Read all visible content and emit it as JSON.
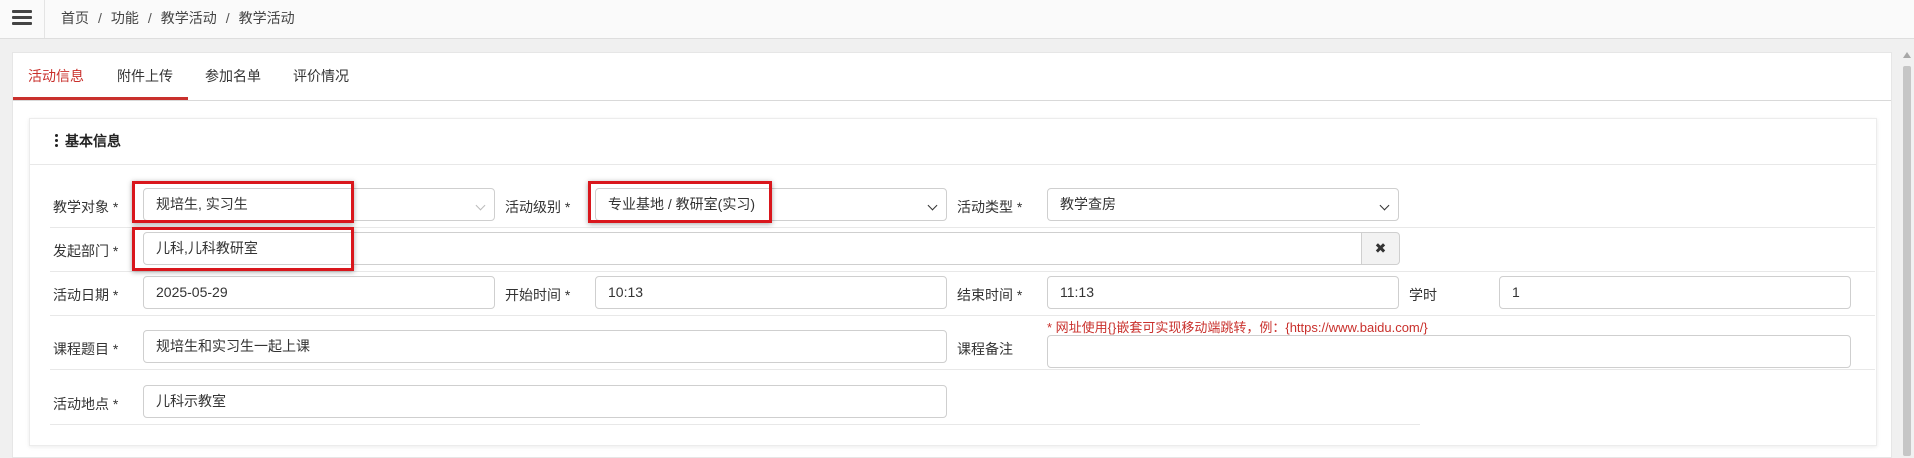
{
  "breadcrumb": {
    "items": [
      "首页",
      "功能",
      "教学活动",
      "教学活动"
    ],
    "separator": "/"
  },
  "tabs": [
    {
      "label": "活动信息",
      "active": true
    },
    {
      "label": "附件上传",
      "active": false
    },
    {
      "label": "参加名单",
      "active": false
    },
    {
      "label": "评价情况",
      "active": false
    }
  ],
  "panel": {
    "title": "基本信息"
  },
  "form": {
    "teaching_target": {
      "label": "教学对象 *",
      "value": "规培生, 实习生"
    },
    "activity_level": {
      "label": "活动级别 *",
      "value": "专业基地 / 教研室(实习)"
    },
    "activity_type": {
      "label": "活动类型 *",
      "value": "教学查房"
    },
    "department": {
      "label": "发起部门 *",
      "value": "儿科,儿科教研室",
      "clear_icon": "times-icon"
    },
    "activity_date": {
      "label": "活动日期 *",
      "value": "2025-05-29"
    },
    "start_time": {
      "label": "开始时间 *",
      "value": "10:13"
    },
    "end_time": {
      "label": "结束时间 *",
      "value": "11:13"
    },
    "credit_hours": {
      "label": "学时",
      "value": "1"
    },
    "course_title": {
      "label": "课程题目 *",
      "value": "规培生和实习生一起上课"
    },
    "course_note": {
      "label": "课程备注",
      "value": "",
      "hint": "* 网址使用{}嵌套可实现移动端跳转，例：{https://www.baidu.com/}"
    },
    "location": {
      "label": "活动地点 *",
      "value": "儿科示教室"
    }
  },
  "colors": {
    "accent": "#c9302c",
    "highlight": "#d9161c",
    "hint": "#c9302c"
  }
}
